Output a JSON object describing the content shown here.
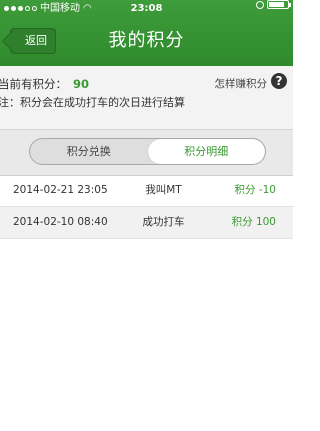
{
  "status": {
    "carrier": "中国移动",
    "time": "23:08",
    "battery_level": 0.85
  },
  "nav": {
    "back_label": "返回",
    "title": "我的积分"
  },
  "points": {
    "label": "当前有积分：",
    "value": "90",
    "how_label": "怎样赚积分",
    "note": "注：积分会在成功打车的次日进行结算"
  },
  "tabs": [
    {
      "label": "积分兑换",
      "active": false
    },
    {
      "label": "积分明细",
      "active": true
    }
  ],
  "records": [
    {
      "date": "2014-02-21 23:05",
      "desc": "我叫MT",
      "points": "积分 -10"
    },
    {
      "date": "2014-02-10 08:40",
      "desc": "成功打车",
      "points": "积分 100"
    }
  ],
  "colors": {
    "brand_green": "#2e8a2c",
    "points_green": "#3a9a2e"
  }
}
